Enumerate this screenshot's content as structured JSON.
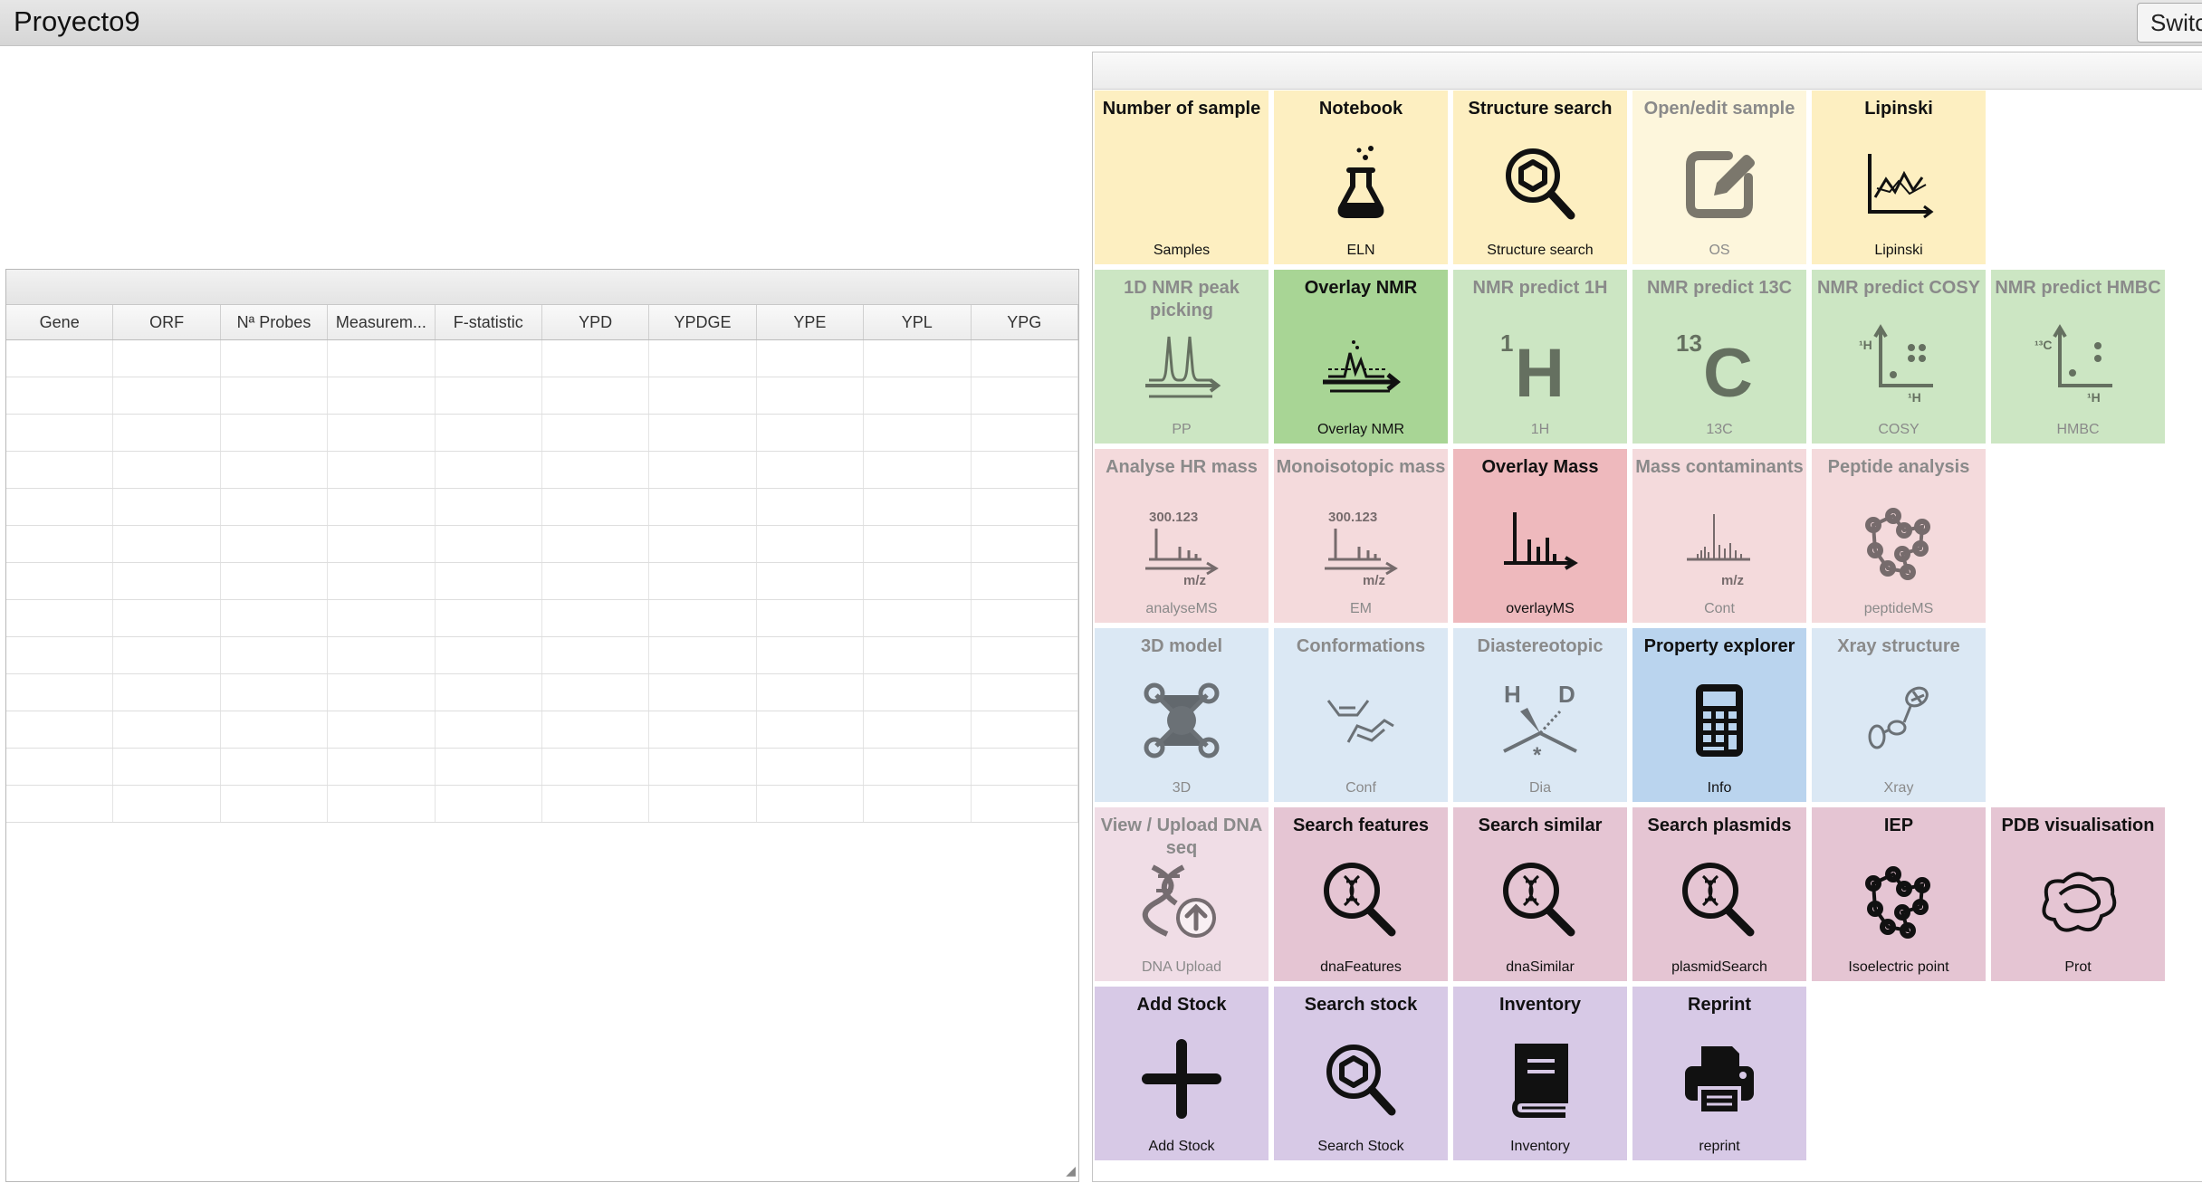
{
  "app": {
    "title": "Proyecto9",
    "switch_label": "Switc"
  },
  "grid": {
    "columns": [
      "Gene",
      "ORF",
      "Nª Probes",
      "Measurem...",
      "F-statistic",
      "YPD",
      "YPDGE",
      "YPE",
      "YPL",
      "YPG"
    ],
    "empty_row_count": 13
  },
  "colors": {
    "yellow": "#fdefc1",
    "yellow_dim": "#fdf6dc",
    "green": "#cce6c3",
    "green_active": "#a8d595",
    "pink": "#f4dadc",
    "pink_active": "#eeb9bd",
    "blue": "#dbe8f4",
    "blue_active": "#bad4ee",
    "purple_pink": "#e5c5d3",
    "purple_pink_dim": "#f0dde6",
    "lavender": "#d7c9e6"
  },
  "tiles": [
    {
      "title": "Number of sample",
      "label": "Samples",
      "icon": "number-of-sample-icon",
      "color": "yellow",
      "dim": false
    },
    {
      "title": "Notebook",
      "label": "ELN",
      "icon": "flask-icon",
      "color": "yellow",
      "dim": false
    },
    {
      "title": "Structure search",
      "label": "Structure search",
      "icon": "structure-search-icon",
      "color": "yellow",
      "dim": false
    },
    {
      "title": "Open/edit sample",
      "label": "OS",
      "icon": "edit-icon",
      "color": "yellow_dim",
      "dim": true
    },
    {
      "title": "Lipinski",
      "label": "Lipinski",
      "icon": "chart-icon",
      "color": "yellow",
      "dim": false
    },
    {
      "title": "1D NMR peak picking",
      "label": "PP",
      "icon": "nmr-peak-icon",
      "color": "green",
      "dim": true
    },
    {
      "title": "Overlay NMR",
      "label": "Overlay NMR",
      "icon": "overlay-nmr-icon",
      "color": "green_active",
      "dim": false
    },
    {
      "title": "NMR predict 1H",
      "label": "1H",
      "icon": "1h-icon",
      "color": "green",
      "dim": true
    },
    {
      "title": "NMR predict 13C",
      "label": "13C",
      "icon": "13c-icon",
      "color": "green",
      "dim": true
    },
    {
      "title": "NMR predict COSY",
      "label": "COSY",
      "icon": "cosy-icon",
      "color": "green",
      "dim": true
    },
    {
      "title": "NMR predict HMBC",
      "label": "HMBC",
      "icon": "hmbc-icon",
      "color": "green",
      "dim": true
    },
    {
      "title": "Analyse HR mass",
      "label": "analyseMS",
      "icon": "mass-spectrum-icon",
      "color": "pink",
      "dim": true,
      "icon_text": "300.123",
      "icon_unit": "m/z"
    },
    {
      "title": "Monoisotopic mass",
      "label": "EM",
      "icon": "mass-spectrum-icon",
      "color": "pink",
      "dim": true,
      "icon_text": "300.123",
      "icon_unit": "m/z"
    },
    {
      "title": "Overlay Mass",
      "label": "overlayMS",
      "icon": "overlay-mass-icon",
      "color": "pink_active",
      "dim": false
    },
    {
      "title": "Mass contaminants",
      "label": "Cont",
      "icon": "mass-contaminants-icon",
      "color": "pink",
      "dim": true,
      "icon_unit": "m/z"
    },
    {
      "title": "Peptide analysis",
      "label": "peptideMS",
      "icon": "peptide-icon",
      "color": "pink",
      "dim": true
    },
    {
      "title": "3D model",
      "label": "3D",
      "icon": "molecule-3d-icon",
      "color": "blue",
      "dim": true
    },
    {
      "title": "Conformations",
      "label": "Conf",
      "icon": "conformations-icon",
      "color": "blue",
      "dim": true
    },
    {
      "title": "Diastereotopic",
      "label": "Dia",
      "icon": "diastereotopic-icon",
      "color": "blue",
      "dim": true
    },
    {
      "title": "Property explorer",
      "label": "Info",
      "icon": "calculator-icon",
      "color": "blue_active",
      "dim": false
    },
    {
      "title": "Xray structure",
      "label": "Xray",
      "icon": "xray-icon",
      "color": "blue",
      "dim": true
    },
    {
      "title": "View / Upload DNA seq",
      "label": "DNA Upload",
      "icon": "dna-upload-icon",
      "color": "purple_pink_dim",
      "dim": true
    },
    {
      "title": "Search features",
      "label": "dnaFeatures",
      "icon": "dna-search-icon",
      "color": "purple_pink",
      "dim": false
    },
    {
      "title": "Search similar",
      "label": "dnaSimilar",
      "icon": "dna-search-icon",
      "color": "purple_pink",
      "dim": false
    },
    {
      "title": "Search plasmids",
      "label": "plasmidSearch",
      "icon": "dna-search-icon",
      "color": "purple_pink",
      "dim": false
    },
    {
      "title": "IEP",
      "label": "Isoelectric point",
      "icon": "peptide-icon",
      "color": "purple_pink",
      "dim": false
    },
    {
      "title": "PDB visualisation",
      "label": "Prot",
      "icon": "protein-icon",
      "color": "purple_pink",
      "dim": false
    },
    {
      "title": "Add Stock",
      "label": "Add Stock",
      "icon": "plus-icon",
      "color": "lavender",
      "dim": false
    },
    {
      "title": "Search stock",
      "label": "Search Stock",
      "icon": "structure-search-icon",
      "color": "lavender",
      "dim": false
    },
    {
      "title": "Inventory",
      "label": "Inventory",
      "icon": "book-icon",
      "color": "lavender",
      "dim": false
    },
    {
      "title": "Reprint",
      "label": "reprint",
      "icon": "printer-icon",
      "color": "lavender",
      "dim": false
    }
  ]
}
